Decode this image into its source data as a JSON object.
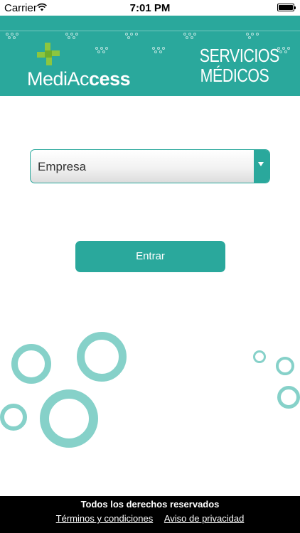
{
  "status_bar": {
    "carrier": "Carrier",
    "time": "7:01 PM",
    "icons": [
      "wifi-icon",
      "battery-icon"
    ]
  },
  "header": {
    "logo_text_light": "MediAc",
    "logo_text_bold": "cess",
    "logo_icon": "medical-cross-icon",
    "title_line1": "SERVICIOS",
    "title_line2": "MÉDICOS"
  },
  "form": {
    "company_select": {
      "selected": "Empresa",
      "icon": "chevron-down-icon"
    },
    "enter_button_label": "Entrar"
  },
  "footer": {
    "rights": "Todos los derechos reservados",
    "terms_link": "Términos y condiciones",
    "privacy_link": "Aviso de privacidad"
  },
  "colors": {
    "brand_teal": "#2aa89c",
    "logo_green": "#8cc63f",
    "ring_teal": "#86d1c9",
    "footer_bg": "#000000"
  }
}
